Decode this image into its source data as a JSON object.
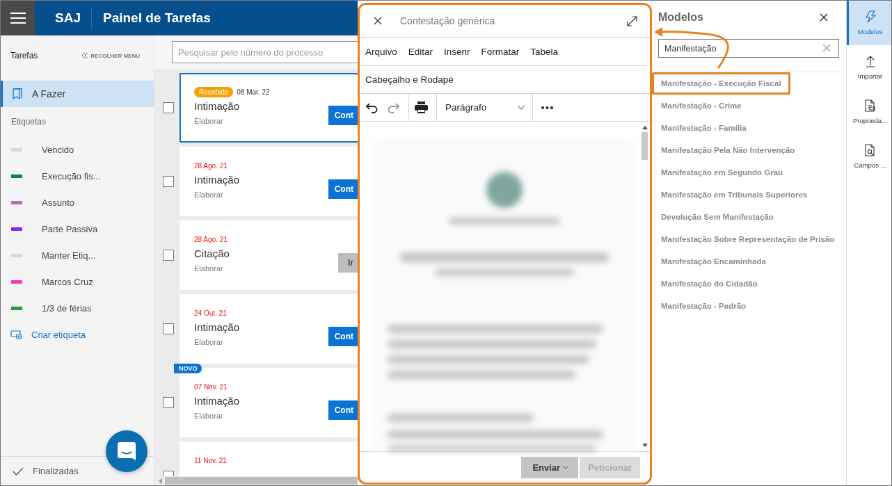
{
  "header": {
    "app": "SAJ",
    "title": "Painel de Tarefas"
  },
  "sidebar": {
    "heading": "Tarefas",
    "collapse": "RECOLHER MENU",
    "items": [
      {
        "label": "A Fazer",
        "selected": true
      }
    ],
    "tags_heading": "Etiquetas",
    "tags": [
      {
        "label": "Vencido",
        "color": "#d9d9d9"
      },
      {
        "label": "Execução fis...",
        "color": "#008272"
      },
      {
        "label": "Assunto",
        "color": "#b86cb0"
      },
      {
        "label": "Parte Passiva",
        "color": "#8a2be2"
      },
      {
        "label": "Manter Etiq...",
        "color": "#d9d9d9"
      },
      {
        "label": "Marcos Cruz",
        "color": "#ee3fb9"
      },
      {
        "label": "1/3 de férias",
        "color": "#1e9e48"
      }
    ],
    "create": "Criar etiqueta",
    "footer": "Finalizadas"
  },
  "tasks": {
    "search": {
      "placeholder": "Pesquisar pelo número do processo"
    },
    "cards": [
      {
        "badge": "Recebido",
        "date": "08 Mar. 22",
        "overdue": false,
        "title": "Intimação",
        "subtitle": "Elaborar",
        "action": "Cont",
        "disabled": false,
        "selected": true,
        "checked": false
      },
      {
        "date": "28 Ago. 21",
        "overdue": true,
        "title": "Intimação",
        "subtitle": "Elaborar",
        "action": "Cont",
        "disabled": false,
        "selected": false,
        "checked": false
      },
      {
        "date": "28 Ago. 21",
        "overdue": true,
        "title": "Citação",
        "subtitle": "Elaborar",
        "action": "Ir",
        "disabled": true,
        "selected": false,
        "checked": false
      },
      {
        "date": "24 Out. 21",
        "overdue": true,
        "title": "Intimação",
        "subtitle": "Elaborar",
        "action": "Cont",
        "disabled": false,
        "selected": false,
        "checked": false
      },
      {
        "flag": "NOVO",
        "date": "07 Nov. 21",
        "overdue": true,
        "title": "Intimação",
        "subtitle": "Elaborar",
        "action": "Cont",
        "disabled": false,
        "selected": false,
        "checked": false
      },
      {
        "date": "11 Nov. 21",
        "overdue": true,
        "selected": false,
        "checked": false
      }
    ]
  },
  "editor": {
    "title": "Contestação genérica",
    "menu": [
      "Arquivo",
      "Editar",
      "Inserir",
      "Formatar",
      "Tabela"
    ],
    "submenu": "Cabeçalho e Rodapé",
    "undo": {
      "disabled": false
    },
    "redo": {
      "disabled": true
    },
    "style_select": "Parágrafo",
    "buttons": [
      {
        "label": "Enviar",
        "kind": "dropdown",
        "disabled": false
      },
      {
        "label": "Peticionar",
        "kind": "plain",
        "disabled": true
      }
    ]
  },
  "models": {
    "title": "Modelos",
    "search": {
      "value": "Manifestação"
    },
    "items": [
      {
        "label": "Manifestação - Execução Fiscal",
        "highlighted": true
      },
      {
        "label": "Manifestação - Crime",
        "highlighted": false
      },
      {
        "label": "Manifestação - Família",
        "highlighted": false
      },
      {
        "label": "Manifestação Pela Não Intervenção",
        "highlighted": false
      },
      {
        "label": "Manifestação em Segundo Grau",
        "highlighted": false
      },
      {
        "label": "Manifestação em Tribunais Superiores",
        "highlighted": false
      },
      {
        "label": "Devolução Sem Manifestação",
        "highlighted": false
      },
      {
        "label": "Manifestação Sobre Representação de Prisão",
        "highlighted": false
      },
      {
        "label": "Manifestação Encaminhada",
        "highlighted": false
      },
      {
        "label": "Manifestação do Cidadão",
        "highlighted": false
      },
      {
        "label": "Manifestação - Padrão",
        "highlighted": false
      }
    ]
  },
  "rail": [
    {
      "label": "Modelos",
      "kind": "bolt",
      "selected": true
    },
    {
      "label": "Importar",
      "kind": "upload",
      "selected": false
    },
    {
      "label": "Proprieda...",
      "kind": "properties",
      "selected": false
    },
    {
      "label": "Campos ...",
      "kind": "fields",
      "selected": false
    }
  ]
}
